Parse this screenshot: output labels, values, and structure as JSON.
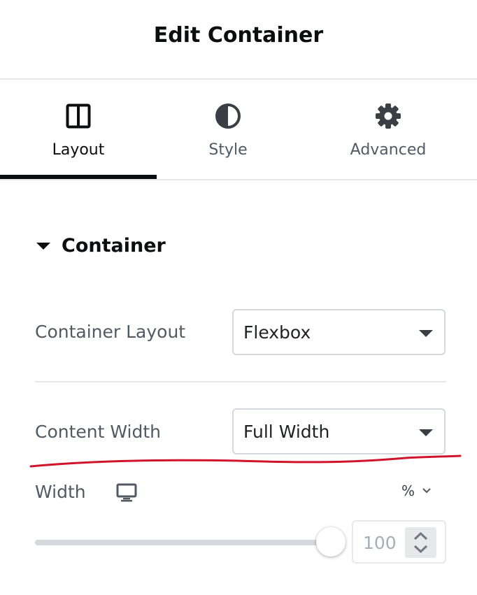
{
  "header": {
    "title": "Edit Container"
  },
  "tabs": [
    {
      "label": "Layout",
      "icon": "columns-icon",
      "active": true
    },
    {
      "label": "Style",
      "icon": "half-circle-icon",
      "active": false
    },
    {
      "label": "Advanced",
      "icon": "gear-icon",
      "active": false
    }
  ],
  "section": {
    "title": "Container",
    "icon": "caret-down-icon"
  },
  "controls": {
    "container_layout": {
      "label": "Container Layout",
      "value": "Flexbox"
    },
    "content_width": {
      "label": "Content Width",
      "value": "Full Width"
    },
    "width": {
      "label": "Width",
      "device_icon": "desktop-icon",
      "unit": "%",
      "value": "100",
      "slider_level_percent": 100
    }
  },
  "annotation": {
    "color": "#d0142c"
  },
  "colors": {
    "text_dark": "#0c0d0e",
    "text_label": "#515962",
    "border": "#d5d8dc",
    "divider": "#e6e8ea"
  }
}
